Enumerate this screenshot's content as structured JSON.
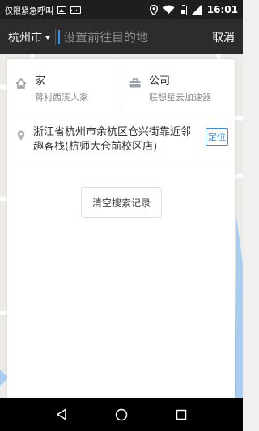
{
  "status_bar": {
    "carrier_text": "仅限紧急呼叫",
    "time": "16:01"
  },
  "search_bar": {
    "city": "杭州市",
    "placeholder": "设置前往目的地",
    "cancel_label": "取消"
  },
  "shortcuts": [
    {
      "title": "家",
      "subtitle": "蒋村西溪人家",
      "icon": "home-icon"
    },
    {
      "title": "公司",
      "subtitle": "联想星云加速器",
      "icon": "briefcase-icon"
    }
  ],
  "current_location": {
    "address": "浙江省杭州市余杭区仓兴街靠近邻趣客栈(杭师大仓前校区店)",
    "tag": "定位",
    "icon": "location-pin-icon"
  },
  "clear_history_label": "清空搜索记录",
  "colors": {
    "accent": "#3a8ee6",
    "header_bg": "#2c2c2c"
  }
}
